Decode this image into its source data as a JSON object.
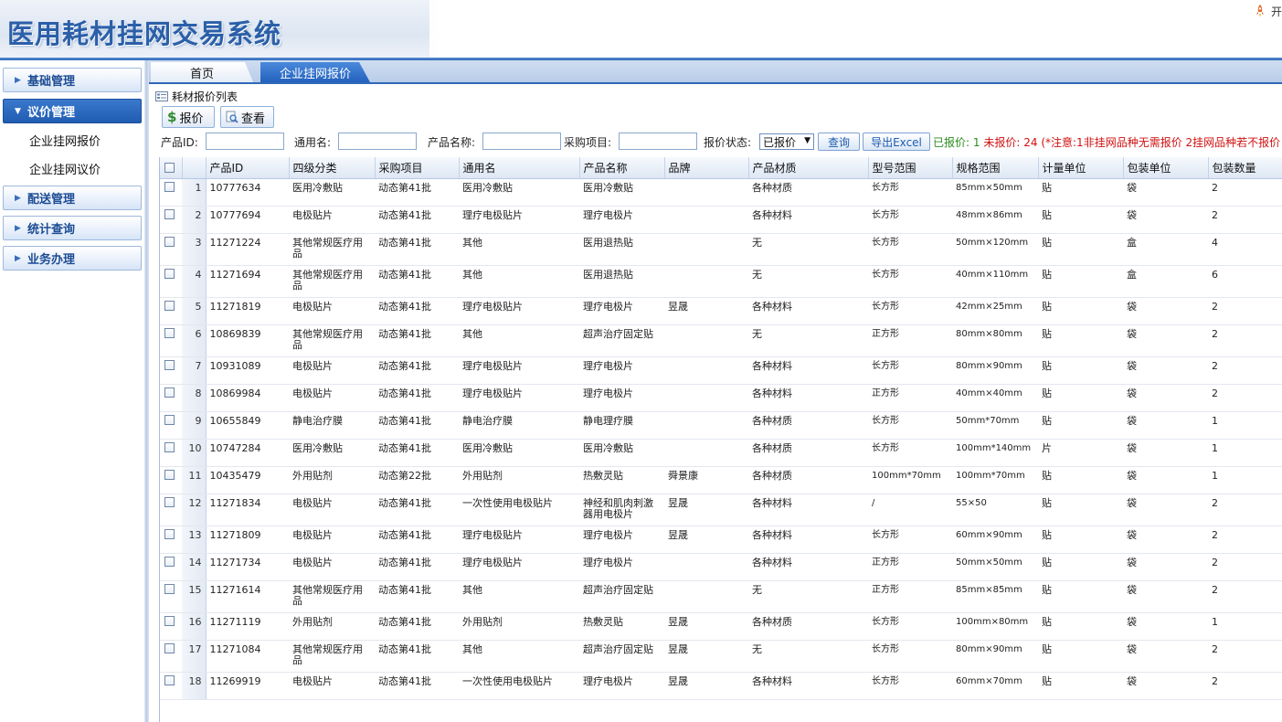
{
  "header": {
    "title": "医用耗材挂网交易系统",
    "user_text": "开"
  },
  "sidebar": {
    "groups": [
      {
        "label": "基础管理",
        "expanded": false
      },
      {
        "label": "议价管理",
        "expanded": true,
        "items": [
          "企业挂网报价",
          "企业挂网议价"
        ]
      },
      {
        "label": "配送管理",
        "expanded": false
      },
      {
        "label": "统计查询",
        "expanded": false
      },
      {
        "label": "业务办理",
        "expanded": false
      }
    ]
  },
  "tabs": [
    "首页",
    "企业挂网报价"
  ],
  "panel": {
    "title": "耗材报价列表",
    "quote_btn": "报价",
    "view_btn": "查看"
  },
  "filters": {
    "product_id_label": "产品ID:",
    "generic_name_label": "通用名:",
    "product_name_label": "产品名称:",
    "project_label": "采购项目:",
    "status_label": "报价状态:",
    "status_value": "已报价",
    "search_btn": "查询",
    "export_btn": "导出Excel",
    "quoted_label": "已报价:",
    "quoted_count": "1",
    "unquoted_label": "未报价:",
    "unquoted_count": "24",
    "note": "(*注意:1非挂网品种无需报价 2挂网品种若不报价"
  },
  "table": {
    "columns": [
      "产品ID",
      "四级分类",
      "采购项目",
      "通用名",
      "产品名称",
      "品牌",
      "产品材质",
      "型号范围",
      "规格范围",
      "计量单位",
      "包装单位",
      "包装数量"
    ],
    "rows": [
      {
        "n": "1",
        "id": "10777634",
        "cat": "医用冷敷贴",
        "proj": "动态第41批",
        "gen": "医用冷敷贴",
        "name": "医用冷敷贴",
        "brand": "",
        "mat": "各种材质",
        "model": "长方形",
        "spec": "85mm×50mm",
        "unit": "贴",
        "pkg": "袋",
        "qty": "2"
      },
      {
        "n": "2",
        "id": "10777694",
        "cat": "电极贴片",
        "proj": "动态第41批",
        "gen": "理疗电极贴片",
        "name": "理疗电极片",
        "brand": "",
        "mat": "各种材料",
        "model": "长方形",
        "spec": "48mm×86mm",
        "unit": "贴",
        "pkg": "袋",
        "qty": "2"
      },
      {
        "n": "3",
        "id": "11271224",
        "cat": "其他常规医疗用品",
        "proj": "动态第41批",
        "gen": "其他",
        "name": "医用退热贴",
        "brand": "",
        "mat": "无",
        "model": "长方形",
        "spec": "50mm×120mm",
        "unit": "贴",
        "pkg": "盒",
        "qty": "4"
      },
      {
        "n": "4",
        "id": "11271694",
        "cat": "其他常规医疗用品",
        "proj": "动态第41批",
        "gen": "其他",
        "name": "医用退热贴",
        "brand": "",
        "mat": "无",
        "model": "长方形",
        "spec": "40mm×110mm",
        "unit": "贴",
        "pkg": "盒",
        "qty": "6"
      },
      {
        "n": "5",
        "id": "11271819",
        "cat": "电极贴片",
        "proj": "动态第41批",
        "gen": "理疗电极贴片",
        "name": "理疗电极片",
        "brand": "昱晟",
        "mat": "各种材料",
        "model": "长方形",
        "spec": "42mm×25mm",
        "unit": "贴",
        "pkg": "袋",
        "qty": "2"
      },
      {
        "n": "6",
        "id": "10869839",
        "cat": "其他常规医疗用品",
        "proj": "动态第41批",
        "gen": "其他",
        "name": "超声治疗固定贴",
        "brand": "",
        "mat": "无",
        "model": "正方形",
        "spec": "80mm×80mm",
        "unit": "贴",
        "pkg": "袋",
        "qty": "2"
      },
      {
        "n": "7",
        "id": "10931089",
        "cat": "电极贴片",
        "proj": "动态第41批",
        "gen": "理疗电极贴片",
        "name": "理疗电极片",
        "brand": "",
        "mat": "各种材料",
        "model": "长方形",
        "spec": "80mm×90mm",
        "unit": "贴",
        "pkg": "袋",
        "qty": "2"
      },
      {
        "n": "8",
        "id": "10869984",
        "cat": "电极贴片",
        "proj": "动态第41批",
        "gen": "理疗电极贴片",
        "name": "理疗电极片",
        "brand": "",
        "mat": "各种材料",
        "model": "正方形",
        "spec": "40mm×40mm",
        "unit": "贴",
        "pkg": "袋",
        "qty": "2"
      },
      {
        "n": "9",
        "id": "10655849",
        "cat": "静电治疗膜",
        "proj": "动态第41批",
        "gen": "静电治疗膜",
        "name": "静电理疗膜",
        "brand": "",
        "mat": "各种材质",
        "model": "长方形",
        "spec": "50mm*70mm",
        "unit": "贴",
        "pkg": "袋",
        "qty": "1"
      },
      {
        "n": "10",
        "id": "10747284",
        "cat": "医用冷敷贴",
        "proj": "动态第41批",
        "gen": "医用冷敷贴",
        "name": "医用冷敷贴",
        "brand": "",
        "mat": "各种材质",
        "model": "长方形",
        "spec": "100mm*140mm",
        "unit": "片",
        "pkg": "袋",
        "qty": "1"
      },
      {
        "n": "11",
        "id": "10435479",
        "cat": "外用贴剂",
        "proj": "动态第22批",
        "gen": "外用贴剂",
        "name": "热敷灵贴",
        "brand": "舜景康",
        "mat": "各种材质",
        "model": "100mm*70mm",
        "spec": "100mm*70mm",
        "unit": "贴",
        "pkg": "袋",
        "qty": "1"
      },
      {
        "n": "12",
        "id": "11271834",
        "cat": "电极贴片",
        "proj": "动态第41批",
        "gen": "一次性使用电极贴片",
        "name": "神经和肌肉刺激器用电极片",
        "brand": "昱晟",
        "mat": "各种材料",
        "model": "/",
        "spec": "55×50",
        "unit": "贴",
        "pkg": "袋",
        "qty": "2"
      },
      {
        "n": "13",
        "id": "11271809",
        "cat": "电极贴片",
        "proj": "动态第41批",
        "gen": "理疗电极贴片",
        "name": "理疗电极片",
        "brand": "昱晟",
        "mat": "各种材料",
        "model": "长方形",
        "spec": "60mm×90mm",
        "unit": "贴",
        "pkg": "袋",
        "qty": "2"
      },
      {
        "n": "14",
        "id": "11271734",
        "cat": "电极贴片",
        "proj": "动态第41批",
        "gen": "理疗电极贴片",
        "name": "理疗电极片",
        "brand": "",
        "mat": "各种材料",
        "model": "正方形",
        "spec": "50mm×50mm",
        "unit": "贴",
        "pkg": "袋",
        "qty": "2"
      },
      {
        "n": "15",
        "id": "11271614",
        "cat": "其他常规医疗用品",
        "proj": "动态第41批",
        "gen": "其他",
        "name": "超声治疗固定贴",
        "brand": "",
        "mat": "无",
        "model": "正方形",
        "spec": "85mm×85mm",
        "unit": "贴",
        "pkg": "袋",
        "qty": "2"
      },
      {
        "n": "16",
        "id": "11271119",
        "cat": "外用贴剂",
        "proj": "动态第41批",
        "gen": "外用贴剂",
        "name": "热敷灵贴",
        "brand": "昱晟",
        "mat": "各种材质",
        "model": "长方形",
        "spec": "100mm×80mm",
        "unit": "贴",
        "pkg": "袋",
        "qty": "1"
      },
      {
        "n": "17",
        "id": "11271084",
        "cat": "其他常规医疗用品",
        "proj": "动态第41批",
        "gen": "其他",
        "name": "超声治疗固定贴",
        "brand": "昱晟",
        "mat": "无",
        "model": "长方形",
        "spec": "80mm×90mm",
        "unit": "贴",
        "pkg": "袋",
        "qty": "2"
      },
      {
        "n": "18",
        "id": "11269919",
        "cat": "电极贴片",
        "proj": "动态第41批",
        "gen": "一次性使用电极贴片",
        "name": "理疗电极片",
        "brand": "昱晟",
        "mat": "各种材料",
        "model": "长方形",
        "spec": "60mm×70mm",
        "unit": "贴",
        "pkg": "袋",
        "qty": "2"
      }
    ]
  },
  "colors": {
    "accent": "#2f68b8",
    "title": "#2b5fa8",
    "quoted": "#2b8a1e",
    "alert": "#d01010"
  }
}
